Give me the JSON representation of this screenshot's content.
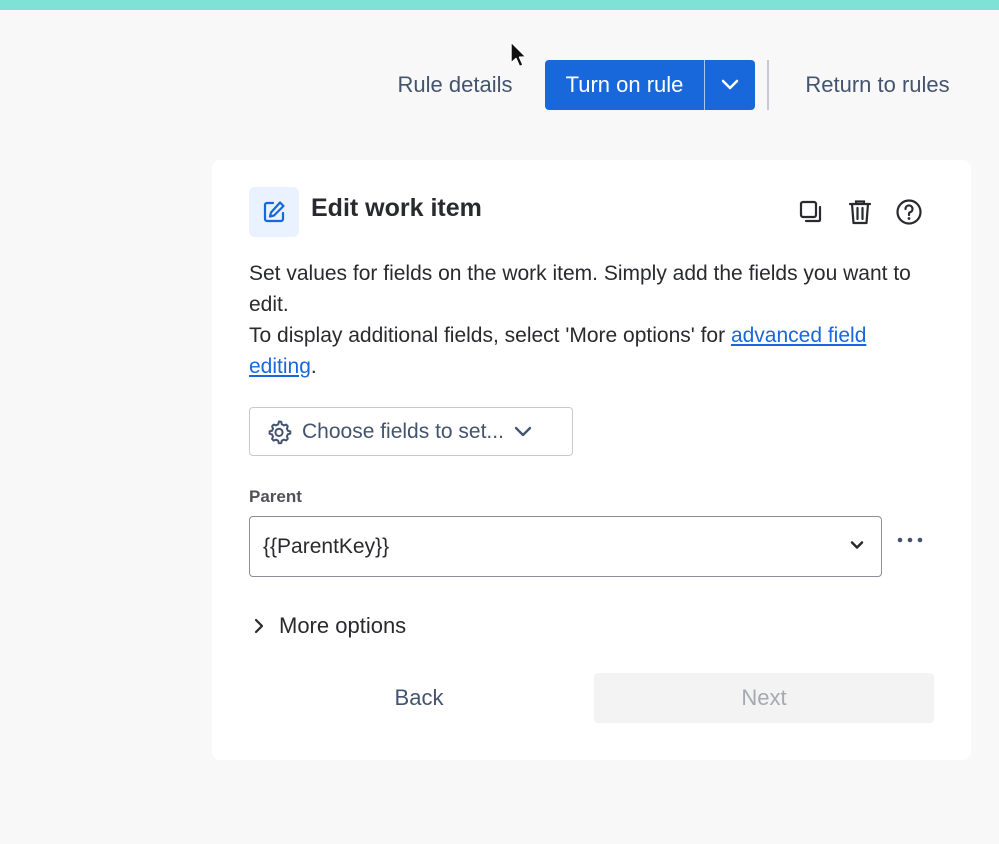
{
  "colors": {
    "accent": "#1868db",
    "top_strip": "#7ee2d7",
    "background": "#f8f8f8",
    "card": "#ffffff"
  },
  "toolbar": {
    "rule_details": "Rule details",
    "turn_on_rule": "Turn on rule",
    "dropdown_icon": "chevron-down-icon",
    "return_to_rules": "Return to rules"
  },
  "card": {
    "icon": "edit-icon",
    "title": "Edit work item",
    "actions": [
      "duplicate-icon",
      "trash-icon",
      "help-icon"
    ],
    "description_line1": "Set values for fields on the work item. Simply add the fields you want to edit.",
    "description_line2_prefix": "To display additional fields, select 'More options' for ",
    "description_link": "advanced field editing",
    "description_line2_suffix": ".",
    "choose_fields": "Choose fields to set...",
    "parent_label": "Parent",
    "parent_value": "{{ParentKey}}",
    "more_options": "More options",
    "back": "Back",
    "next": "Next"
  }
}
